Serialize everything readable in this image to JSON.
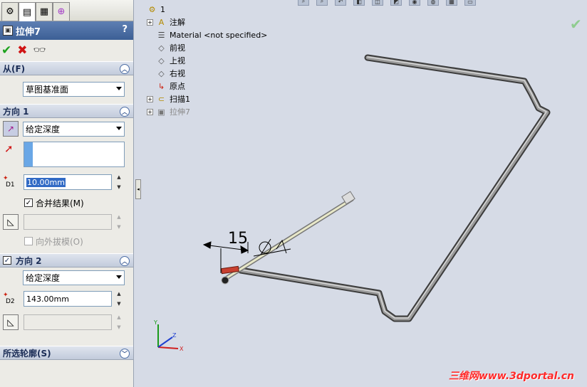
{
  "panel": {
    "tabs": [
      "feature-manager",
      "property-manager",
      "configuration-manager",
      "dim-expert"
    ],
    "title": "拉伸7",
    "help": "?",
    "from": {
      "header": "从(F)",
      "start_condition": "草图基准面"
    },
    "direction1": {
      "header": "方向 1",
      "end_condition": "给定深度",
      "depth_label": "D1",
      "depth_value": "10.00mm",
      "merge_label": "合并结果(M)",
      "merge_checked": true,
      "draft_label": "向外拔模(O)"
    },
    "direction2": {
      "header": "方向 2",
      "checked": true,
      "end_condition": "给定深度",
      "depth_label": "D2",
      "depth_value": "143.00mm"
    },
    "selected_contours": {
      "header": "所选轮廓(S)"
    }
  },
  "tree": {
    "root": "1",
    "items": [
      {
        "label": "注解",
        "icon": "annotation-icon",
        "expandable": true,
        "grey": false
      },
      {
        "label": "Material <not specified>",
        "icon": "material-icon",
        "expandable": false,
        "grey": false
      },
      {
        "label": "前视",
        "icon": "plane-icon",
        "expandable": false,
        "grey": false
      },
      {
        "label": "上视",
        "icon": "plane-icon",
        "expandable": false,
        "grey": false
      },
      {
        "label": "右视",
        "icon": "plane-icon",
        "expandable": false,
        "grey": false
      },
      {
        "label": "原点",
        "icon": "origin-icon",
        "expandable": false,
        "grey": false
      },
      {
        "label": "扫描1",
        "icon": "sweep-icon",
        "expandable": true,
        "grey": false
      },
      {
        "label": "拉伸7",
        "icon": "extrude-icon",
        "expandable": true,
        "grey": true
      }
    ]
  },
  "viewport": {
    "dimension_value": "15",
    "triad": {
      "x": "X",
      "y": "Y",
      "z": "Z"
    }
  },
  "watermark": "三维网www.3dportal.cn",
  "colors": {
    "title_bar": "#4a6ca2",
    "ok": "#1da21d",
    "cancel": "#d01414",
    "watermark": "#ff2a2a"
  }
}
